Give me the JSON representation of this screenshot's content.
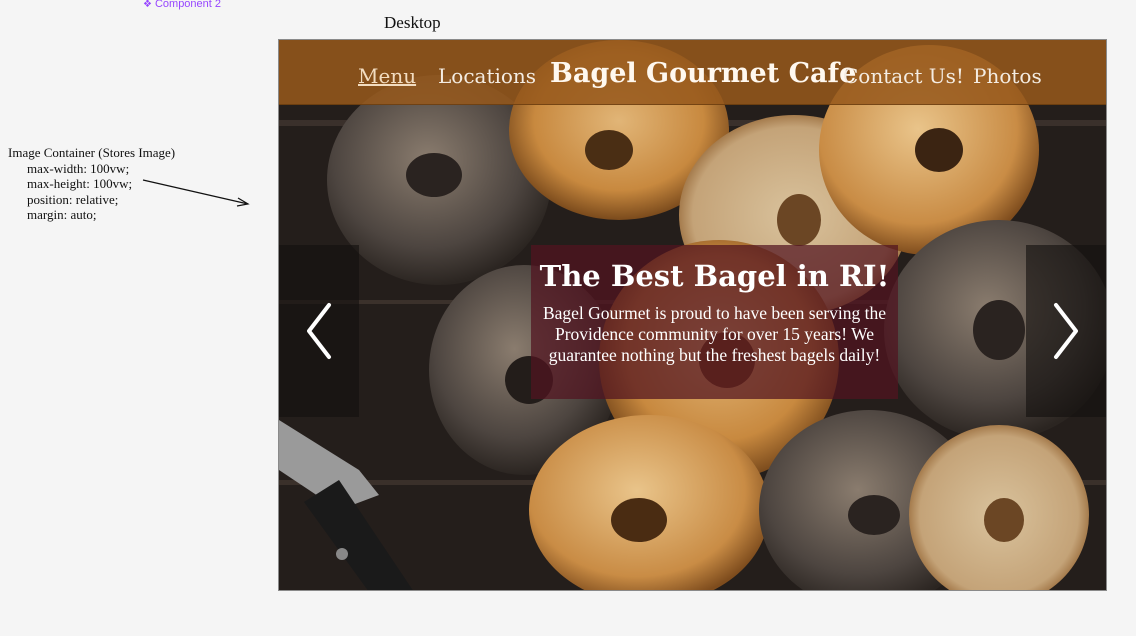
{
  "canvas": {
    "component_label": "Component 2",
    "frame_label": "Desktop"
  },
  "annotation": {
    "title": "Image Container (Stores Image)",
    "lines": [
      "max-width: 100vw;",
      "max-height: 100vw;",
      "position: relative;",
      "margin: auto;"
    ]
  },
  "nav": {
    "menu": "Menu",
    "locations": "Locations",
    "brand": "Bagel Gourmet Cafe",
    "contact": "Contact Us!",
    "photos": "Photos"
  },
  "hero": {
    "title": "The Best Bagel in RI!",
    "body": "Bagel Gourmet is proud to have been serving the Providence community for over 15 years! We guarantee nothing but the freshest bagels daily!"
  },
  "colors": {
    "navbar": "#96581c",
    "hero_box": "#521420",
    "component_label": "#9747ff"
  },
  "icons": {
    "prev": "chevron-left-icon",
    "next": "chevron-right-icon",
    "component": "component-diamond-icon"
  }
}
